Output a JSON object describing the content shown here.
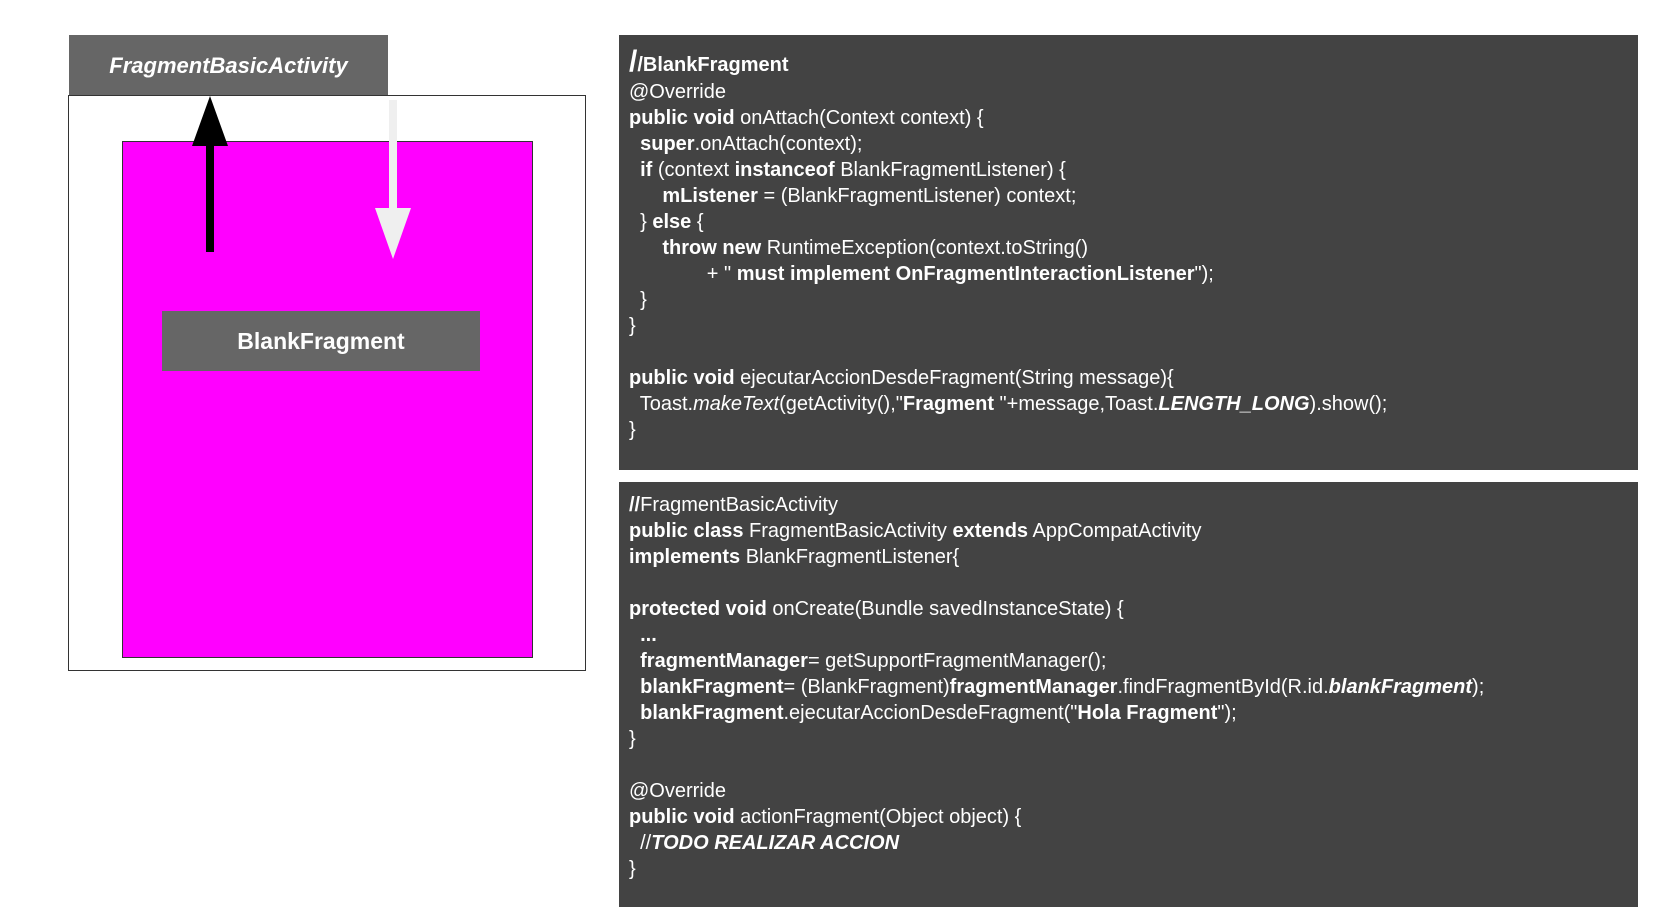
{
  "diagram": {
    "activity_label": "FragmentBasicActivity",
    "fragment_label": "BlankFragment",
    "colors": {
      "label_bg": "#666666",
      "fragment_container": "#ff00ff",
      "up_arrow": "#000000",
      "down_arrow": "#efefef",
      "code_bg": "#434343"
    }
  },
  "blank_fragment_code": [
    [
      {
        "t": "/",
        "s": "big"
      },
      {
        "t": "/BlankFragment",
        "s": "b"
      }
    ],
    [
      {
        "t": "@Override"
      }
    ],
    [
      {
        "t": "public void",
        "s": "b"
      },
      {
        "t": " onAttach(Context context) {"
      }
    ],
    [
      {
        "t": "  "
      },
      {
        "t": "super",
        "s": "b"
      },
      {
        "t": ".onAttach(context);"
      }
    ],
    [
      {
        "t": "  "
      },
      {
        "t": "if",
        "s": "b"
      },
      {
        "t": " (context "
      },
      {
        "t": "instanceof",
        "s": "b"
      },
      {
        "t": " BlankFragmentListener) {"
      }
    ],
    [
      {
        "t": "      "
      },
      {
        "t": "mListener",
        "s": "b"
      },
      {
        "t": " = (BlankFragmentListener) context;"
      }
    ],
    [
      {
        "t": "  } "
      },
      {
        "t": "else",
        "s": "b"
      },
      {
        "t": " {"
      }
    ],
    [
      {
        "t": "      "
      },
      {
        "t": "throw new",
        "s": "b"
      },
      {
        "t": " RuntimeException(context.toString()"
      }
    ],
    [
      {
        "t": "              + \" "
      },
      {
        "t": "must implement OnFragmentInteractionListener",
        "s": "b"
      },
      {
        "t": "\");"
      }
    ],
    [
      {
        "t": "  }"
      }
    ],
    [
      {
        "t": "}"
      }
    ],
    [
      {
        "t": ""
      }
    ],
    [
      {
        "t": "public void",
        "s": "b"
      },
      {
        "t": " ejecutarAccionDesdeFragment(String message){"
      }
    ],
    [
      {
        "t": "  Toast."
      },
      {
        "t": "makeText",
        "s": "i"
      },
      {
        "t": "(getActivity(),\""
      },
      {
        "t": "Fragment",
        "s": "b"
      },
      {
        "t": " \"+message,Toast."
      },
      {
        "t": "LENGTH_LONG",
        "s": "bi"
      },
      {
        "t": ").show();"
      }
    ],
    [
      {
        "t": "}"
      }
    ]
  ],
  "activity_code": [
    [
      {
        "t": "//",
        "s": "b"
      },
      {
        "t": "FragmentBasicActivity"
      }
    ],
    [
      {
        "t": "public class",
        "s": "b"
      },
      {
        "t": " FragmentBasicActivity "
      },
      {
        "t": "extends",
        "s": "b"
      },
      {
        "t": " AppCompatActivity"
      }
    ],
    [
      {
        "t": "implements",
        "s": "b"
      },
      {
        "t": " BlankFragmentListener{"
      }
    ],
    [
      {
        "t": ""
      }
    ],
    [
      {
        "t": "protected void",
        "s": "b"
      },
      {
        "t": " onCreate(Bundle savedInstanceState) {"
      }
    ],
    [
      {
        "t": "  "
      },
      {
        "t": "...",
        "s": "b"
      }
    ],
    [
      {
        "t": "  "
      },
      {
        "t": "fragmentManager",
        "s": "b"
      },
      {
        "t": "= getSupportFragmentManager();"
      }
    ],
    [
      {
        "t": "  "
      },
      {
        "t": "blankFragment",
        "s": "b"
      },
      {
        "t": "= (BlankFragment)"
      },
      {
        "t": "fragmentManager",
        "s": "b"
      },
      {
        "t": ".findFragmentById(R.id."
      },
      {
        "t": "blankFragment",
        "s": "bi"
      },
      {
        "t": ");"
      }
    ],
    [
      {
        "t": "  "
      },
      {
        "t": "blankFragment",
        "s": "b"
      },
      {
        "t": ".ejecutarAccionDesdeFragment(\""
      },
      {
        "t": "Hola Fragment",
        "s": "b"
      },
      {
        "t": "\");"
      }
    ],
    [
      {
        "t": "}"
      }
    ],
    [
      {
        "t": ""
      }
    ],
    [
      {
        "t": "@Override"
      }
    ],
    [
      {
        "t": "public void",
        "s": "b"
      },
      {
        "t": " actionFragment(Object object) {"
      }
    ],
    [
      {
        "t": "  //"
      },
      {
        "t": "TODO REALIZAR ACCION",
        "s": "bi"
      }
    ],
    [
      {
        "t": "}"
      }
    ]
  ]
}
